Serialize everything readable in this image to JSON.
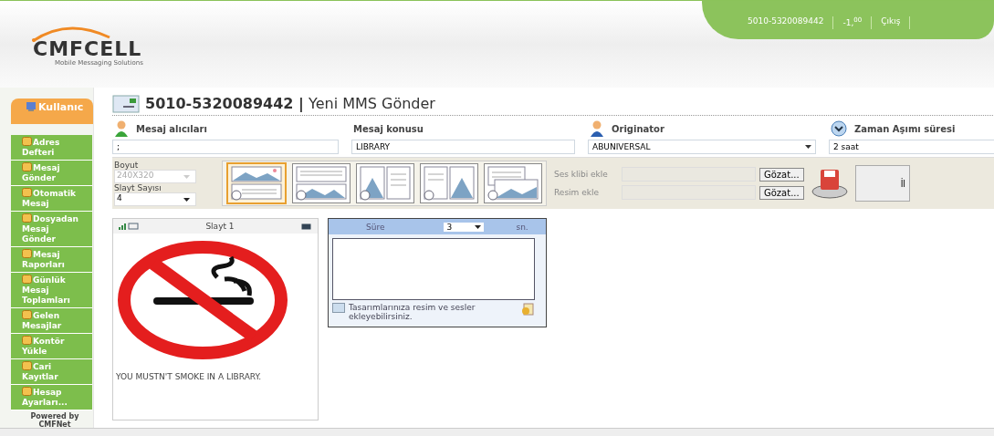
{
  "header": {
    "logo": "CMFCELL",
    "tagline": "Mobile Messaging Solutions",
    "user": "5010-5320089442",
    "credit_base": "-1,",
    "credit_sup": "00",
    "logout": "Çıkış"
  },
  "sidebar": {
    "title": "Kullanıc",
    "items": [
      {
        "label": "Adres Defteri"
      },
      {
        "label": "Mesaj Gönder"
      },
      {
        "label": "Otomatik Mesaj"
      },
      {
        "label": "Dosyadan Mesaj Gönder"
      },
      {
        "label": "Mesaj Raporları"
      },
      {
        "label": "Günlük Mesaj Toplamları"
      },
      {
        "label": "Gelen Mesajlar"
      },
      {
        "label": "Kontör Yükle"
      },
      {
        "label": "Cari Kayıtlar"
      },
      {
        "label": "Hesap Ayarları..."
      }
    ],
    "footer": [
      "Powered by",
      "CMFNet"
    ]
  },
  "page_title": {
    "number": "5010-5320089442",
    "separator": "|",
    "text": "Yeni MMS Gönder"
  },
  "fields": [
    {
      "label": "Mesaj alıcıları",
      "value": ";",
      "kind": "text"
    },
    {
      "label": "Mesaj konusu",
      "value": "LIBRARY",
      "kind": "text"
    },
    {
      "label": "Originator",
      "value": "ABUNIVERSAL",
      "kind": "select"
    },
    {
      "label": "Zaman Aşımı süresi",
      "value": "2 saat",
      "kind": "text"
    }
  ],
  "size": {
    "label": "Boyut",
    "value": "240X320",
    "disabled": true
  },
  "slide_count": {
    "label": "Slayt Sayısı",
    "value": "4"
  },
  "layouts": [
    {
      "kind": "image-top",
      "selected": true
    },
    {
      "kind": "text-top",
      "selected": false
    },
    {
      "kind": "image-left",
      "selected": false
    },
    {
      "kind": "text-left",
      "selected": false
    },
    {
      "kind": "text-over-image",
      "selected": false
    }
  ],
  "attachments": [
    {
      "label": "Ses klibi ekle",
      "button": "Gözat..."
    },
    {
      "label": "Resim ekle",
      "button": "Gözat..."
    }
  ],
  "next_button": "İl",
  "slide": {
    "title": "Slayt 1",
    "caption": "YOU MUSTN'T SMOKE IN A LIBRARY."
  },
  "duration": {
    "label": "Süre",
    "value": "3",
    "unit": "sn.",
    "hint": "Tasarımlarınıza resim ve sesler ekleyebilirsiniz."
  }
}
